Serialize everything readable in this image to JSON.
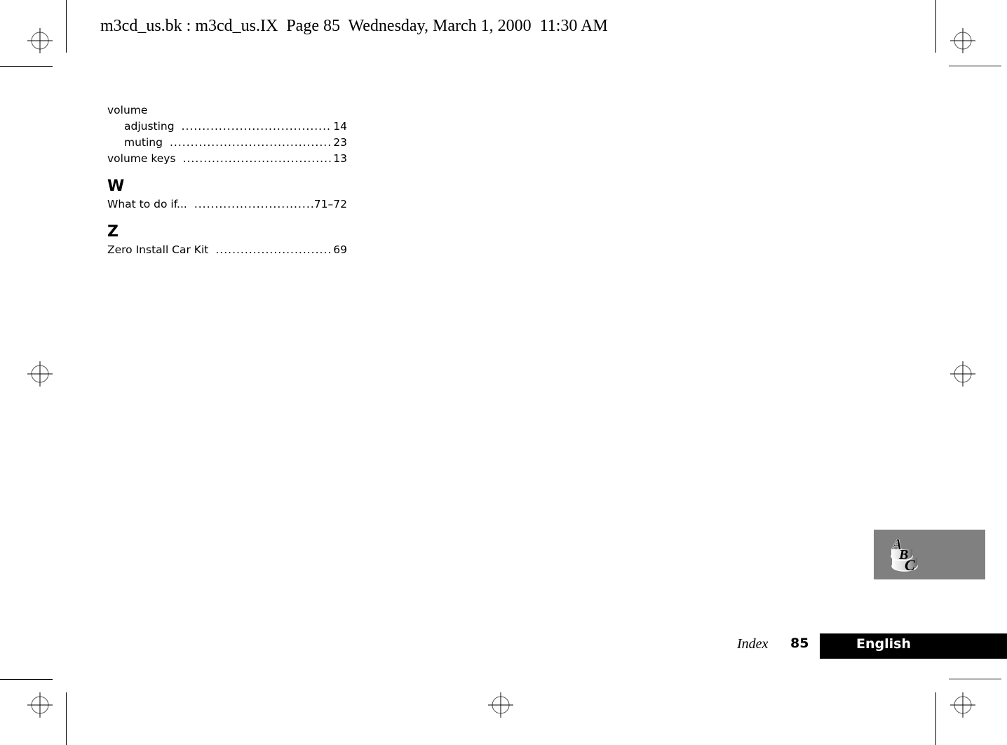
{
  "header": {
    "slug": "m3cd_us.bk : m3cd_us.IX  Page 85  Wednesday, March 1, 2000  11:30 AM"
  },
  "index": {
    "sections": [
      {
        "letter": "",
        "entries": [
          {
            "term": "volume",
            "page": "",
            "level": 0
          },
          {
            "term": "adjusting",
            "page": "14",
            "level": 1
          },
          {
            "term": "muting",
            "page": "23",
            "level": 1
          },
          {
            "term": "volume keys",
            "page": "13",
            "level": 0
          }
        ]
      },
      {
        "letter": "W",
        "entries": [
          {
            "term": "What to do if...",
            "page": "71–72",
            "level": 0
          }
        ]
      },
      {
        "letter": "Z",
        "entries": [
          {
            "term": "Zero Install Car Kit",
            "page": "69",
            "level": 0
          }
        ]
      }
    ]
  },
  "tab_icon": {
    "letters": [
      "A",
      "B",
      "C"
    ],
    "background": "#808080"
  },
  "footer": {
    "section": "Index",
    "page_number": "85",
    "language": "English"
  }
}
